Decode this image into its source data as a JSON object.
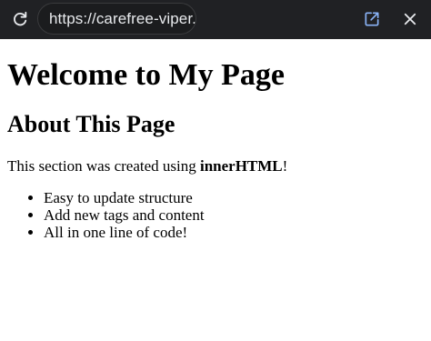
{
  "browser": {
    "url": "https://carefree-viper.co",
    "icons": {
      "reload": "reload-icon",
      "open_external": "open-external-icon",
      "close": "close-icon"
    },
    "colors": {
      "toolbar_bg": "#202124",
      "open_external_accent": "#8ab4f8"
    }
  },
  "page": {
    "heading": "Welcome to My Page",
    "subheading": "About This Page",
    "intro": {
      "prefix": "This section was created using ",
      "emphasis": "innerHTML",
      "suffix": "!"
    },
    "list_items": [
      "Easy to update structure",
      "Add new tags and content",
      "All in one line of code!"
    ]
  }
}
